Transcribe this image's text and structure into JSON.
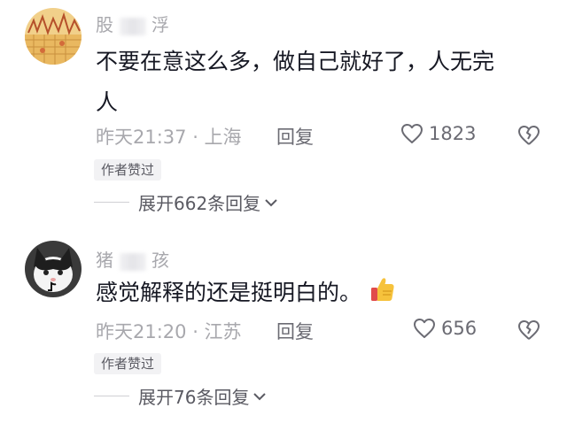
{
  "comments": [
    {
      "username_left": "股",
      "username_right": "浮",
      "text_line1": "不要在意这么多，做自己就好了，人无完",
      "text_line2": "人",
      "time_location": "昨天21:37 · 上海",
      "reply_label": "回复",
      "like_count": "1823",
      "author_badge": "作者赞过",
      "expand_label": "展开662条回复"
    },
    {
      "username_left": "猪",
      "username_right": "孩",
      "text": "感觉解释的还是挺明白的。",
      "time_location": "昨天21:20 · 江苏",
      "reply_label": "回复",
      "like_count": "656",
      "author_badge": "作者赞过",
      "expand_label": "展开76条回复"
    }
  ],
  "icons": {
    "like": "heart-outline-icon",
    "dislike": "broken-heart-icon",
    "expand": "chevron-down-icon",
    "emoji": "thumbs-up-emoji"
  },
  "colors": {
    "text": "#161823",
    "muted": "#a8a8ad",
    "badge_bg": "#f2f2f4"
  }
}
